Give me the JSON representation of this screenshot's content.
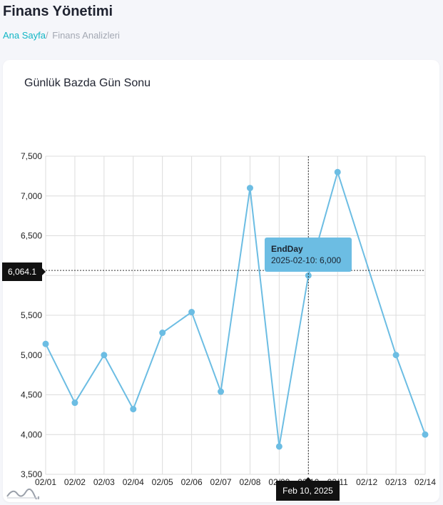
{
  "header": {
    "title": "Finans Yönetimi",
    "breadcrumb_home": "Ana Sayfa",
    "breadcrumb_separator": "/",
    "breadcrumb_current": "Finans Analizleri"
  },
  "card": {
    "title": "Günlük Bazda Gün Sonu"
  },
  "crosshair": {
    "y_value_label": "6,064.1",
    "x_value_label": "Feb 10, 2025"
  },
  "tooltip": {
    "series": "EndDay",
    "text": "2025-02-10: 6,000"
  },
  "colors": {
    "accent": "#11b6c5",
    "series": "#6cbde3",
    "text": "#1f2330"
  },
  "icons": {
    "chart_logo": "mountain-wave-icon"
  },
  "chart_data": {
    "type": "line",
    "title": "Günlük Bazda Gün Sonu",
    "xlabel": "",
    "ylabel": "",
    "categories": [
      "02/01",
      "02/02",
      "02/03",
      "02/04",
      "02/05",
      "02/06",
      "02/07",
      "02/08",
      "02/09",
      "02/10",
      "02/11",
      "02/12",
      "02/13",
      "02/14"
    ],
    "x_dates": [
      "2025-02-01",
      "2025-02-02",
      "2025-02-03",
      "2025-02-04",
      "2025-02-05",
      "2025-02-06",
      "2025-02-07",
      "2025-02-08",
      "2025-02-09",
      "2025-02-10",
      "2025-02-11",
      "2025-02-12",
      "2025-02-13",
      "2025-02-14"
    ],
    "y_ticks": [
      "3,500",
      "4,000",
      "4,500",
      "5,000",
      "5,500",
      "6,000",
      "6,500",
      "7,000",
      "7,500"
    ],
    "ylim": [
      3500,
      7500
    ],
    "series": [
      {
        "name": "EndDay",
        "points": [
          {
            "x": "2025-02-01",
            "y": 5140
          },
          {
            "x": "2025-02-02",
            "y": 4400
          },
          {
            "x": "2025-02-03",
            "y": 5000
          },
          {
            "x": "2025-02-04",
            "y": 4320
          },
          {
            "x": "2025-02-05",
            "y": 5280
          },
          {
            "x": "2025-02-06",
            "y": 5540
          },
          {
            "x": "2025-02-07",
            "y": 4540
          },
          {
            "x": "2025-02-08",
            "y": 7100
          },
          {
            "x": "2025-02-09",
            "y": 3850
          },
          {
            "x": "2025-02-10",
            "y": 6000
          },
          {
            "x": "2025-02-11",
            "y": 7300
          },
          {
            "x": "2025-02-13",
            "y": 5000
          },
          {
            "x": "2025-02-14",
            "y": 4000
          }
        ]
      }
    ],
    "grid": true,
    "legend": "none"
  }
}
